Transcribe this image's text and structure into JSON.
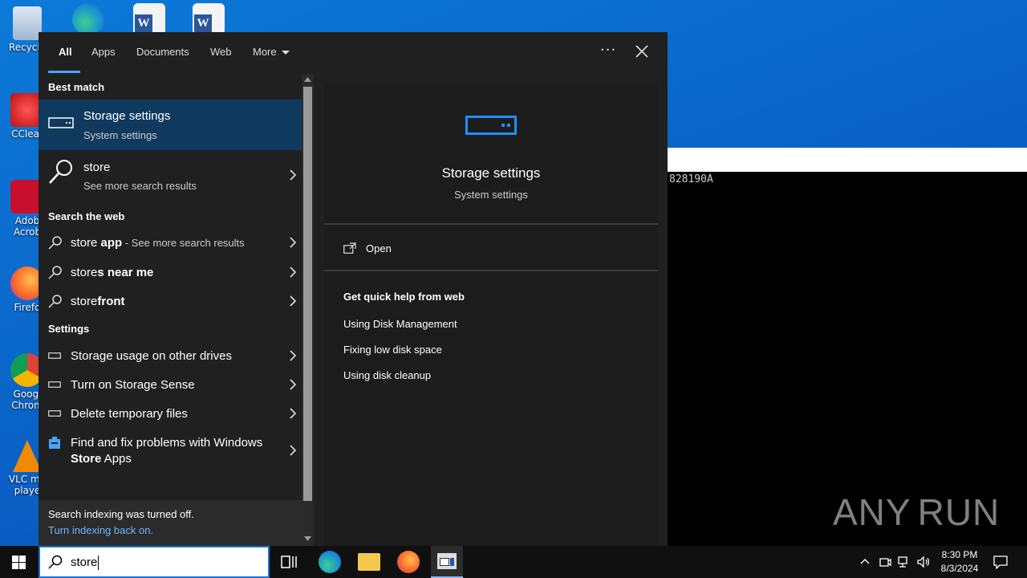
{
  "desktop": {
    "icons": [
      {
        "label": "Recycle",
        "icon": "recycle-bin-icon"
      },
      {
        "label": "CClear",
        "icon": "ccleaner-icon"
      },
      {
        "label": "Adob Acrob",
        "icon": "adobe-acrobat-icon"
      },
      {
        "label": "Firefo",
        "icon": "firefox-icon"
      },
      {
        "label": "Googl Chrom",
        "icon": "chrome-icon"
      },
      {
        "label": "VLC me playe",
        "icon": "vlc-icon"
      }
    ]
  },
  "console": {
    "text": "828190A"
  },
  "watermark": {
    "left": "ANY",
    "right": "RUN"
  },
  "search": {
    "tabs": [
      {
        "label": "All",
        "active": true
      },
      {
        "label": "Apps"
      },
      {
        "label": "Documents"
      },
      {
        "label": "Web"
      },
      {
        "label": "More"
      }
    ],
    "ellipsis": "···",
    "sections": {
      "best_match": "Best match",
      "search_web": "Search the web",
      "settings": "Settings"
    },
    "best": {
      "title": "Storage settings",
      "subtitle": "System settings"
    },
    "store_row": {
      "title": "store",
      "subtitle": "See more search results"
    },
    "web_results": [
      {
        "prefix": "store",
        "bold": " app",
        "suffix": " - See more search results"
      },
      {
        "prefix": "store",
        "bold": "s near me",
        "suffix": ""
      },
      {
        "prefix": "store",
        "bold": "front",
        "suffix": ""
      }
    ],
    "settings_results": [
      {
        "label": "Storage usage on other drives"
      },
      {
        "label": "Turn on Storage Sense"
      },
      {
        "label": "Delete temporary files"
      },
      {
        "line1": "Find and fix problems with Windows",
        "line2_bold": "Store",
        "line2_rest": " Apps"
      }
    ],
    "footer": {
      "notice": "Search indexing was turned off.",
      "link": "Turn indexing back on."
    },
    "preview": {
      "title": "Storage settings",
      "subtitle": "System settings",
      "open_label": "Open",
      "quick_help_head": "Get quick help from web",
      "quick_links": [
        "Using Disk Management",
        "Fixing low disk space",
        "Using disk cleanup"
      ]
    },
    "query": "store"
  },
  "taskbar": {
    "time": "8:30 PM",
    "date": "8/3/2024"
  },
  "colors": {
    "accent": "#4aa3ff",
    "selected_row": "#0f3a5e",
    "panel": "#202020"
  }
}
